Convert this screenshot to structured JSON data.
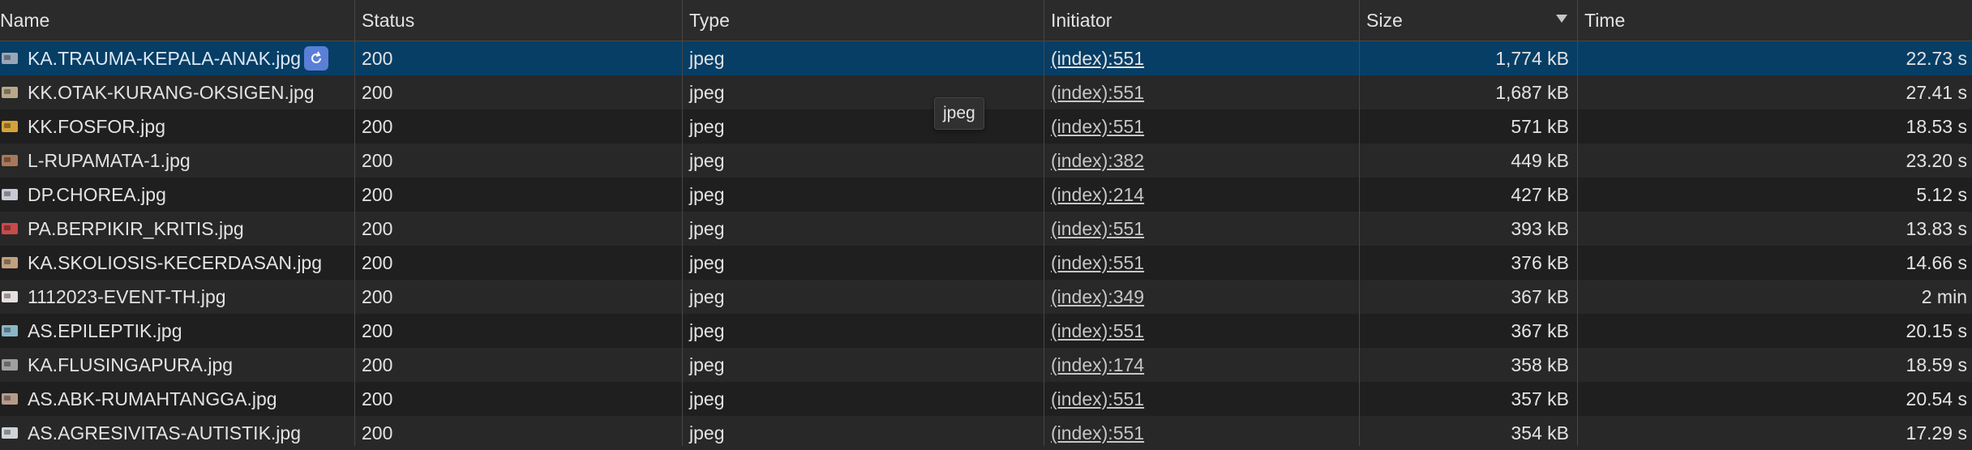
{
  "headers": {
    "name": "Name",
    "status": "Status",
    "type": "Type",
    "initiator": "Initiator",
    "size": "Size",
    "time": "Time"
  },
  "sort": {
    "column": "size",
    "direction": "descending"
  },
  "tooltip": "jpeg",
  "colors": {
    "selected_row": "#073e66",
    "refresh_button": "#5a7fd6"
  },
  "rows": [
    {
      "name": "KA.TRAUMA-KEPALA-ANAK.jpg",
      "status": "200",
      "type": "jpeg",
      "initiator": "(index):551",
      "size": "1,774 kB",
      "time": "22.73 s",
      "thumb": "#9aa6b8",
      "selected": true
    },
    {
      "name": "KK.OTAK-KURANG-OKSIGEN.jpg",
      "status": "200",
      "type": "jpeg",
      "initiator": "(index):551",
      "size": "1,687 kB",
      "time": "27.41 s",
      "thumb": "#b8a88a"
    },
    {
      "name": "KK.FOSFOR.jpg",
      "status": "200",
      "type": "jpeg",
      "initiator": "(index):551",
      "size": "571 kB",
      "time": "18.53 s",
      "thumb": "#d6a33a"
    },
    {
      "name": "L-RUPAMATA-1.jpg",
      "status": "200",
      "type": "jpeg",
      "initiator": "(index):382",
      "size": "449 kB",
      "time": "23.20 s",
      "thumb": "#a8785a"
    },
    {
      "name": "DP.CHOREA.jpg",
      "status": "200",
      "type": "jpeg",
      "initiator": "(index):214",
      "size": "427 kB",
      "time": "5.12 s",
      "thumb": "#c9c9d6"
    },
    {
      "name": "PA.BERPIKIR_KRITIS.jpg",
      "status": "200",
      "type": "jpeg",
      "initiator": "(index):551",
      "size": "393 kB",
      "time": "13.83 s",
      "thumb": "#c84a4a"
    },
    {
      "name": "KA.SKOLIOSIS-KECERDASAN.jpg",
      "status": "200",
      "type": "jpeg",
      "initiator": "(index):551",
      "size": "376 kB",
      "time": "14.66 s",
      "thumb": "#c2a080"
    },
    {
      "name": "1112023-EVENT-TH.jpg",
      "status": "200",
      "type": "jpeg",
      "initiator": "(index):349",
      "size": "367 kB",
      "time": "2 min",
      "thumb": "#e6e0e0"
    },
    {
      "name": "AS.EPILEPTIK.jpg",
      "status": "200",
      "type": "jpeg",
      "initiator": "(index):551",
      "size": "367 kB",
      "time": "20.15 s",
      "thumb": "#8ab6c8"
    },
    {
      "name": "KA.FLUSINGAPURA.jpg",
      "status": "200",
      "type": "jpeg",
      "initiator": "(index):174",
      "size": "358 kB",
      "time": "18.59 s",
      "thumb": "#a0a0a0"
    },
    {
      "name": "AS.ABK-RUMAHTANGGA.jpg",
      "status": "200",
      "type": "jpeg",
      "initiator": "(index):551",
      "size": "357 kB",
      "time": "20.54 s",
      "thumb": "#b89a8a"
    },
    {
      "name": "AS.AGRESIVITAS-AUTISTIK.jpg",
      "status": "200",
      "type": "jpeg",
      "initiator": "(index):551",
      "size": "354 kB",
      "time": "17.29 s",
      "thumb": "#d0d4d8"
    }
  ]
}
